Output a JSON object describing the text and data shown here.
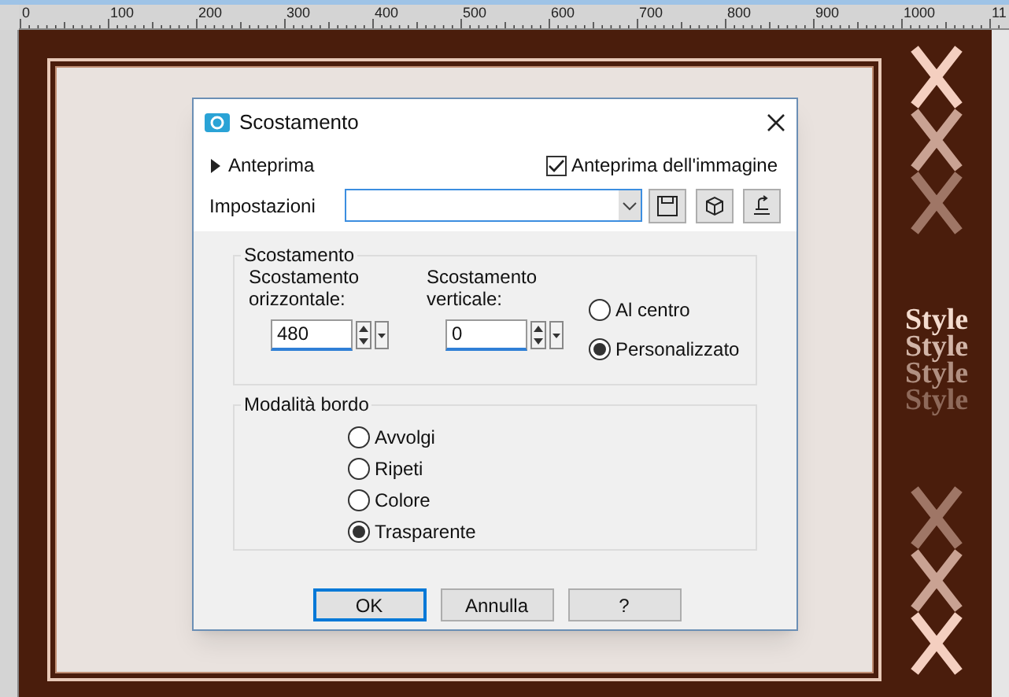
{
  "ruler": {
    "labels": [
      "0",
      "100",
      "200",
      "300",
      "400",
      "500",
      "600",
      "700",
      "800",
      "900",
      "1000",
      "11"
    ]
  },
  "artwork": {
    "style_texts": [
      "Style",
      "Style",
      "Style",
      "Style"
    ]
  },
  "dialog": {
    "title": "Scostamento",
    "preview_toggle": {
      "label": "Anteprima",
      "expanded": false
    },
    "image_preview": {
      "label": "Anteprima dell'immagine",
      "checked": true
    },
    "settings": {
      "label": "Impostazioni"
    },
    "offset_group": {
      "title": "Scostamento",
      "horizontal": {
        "label": "Scostamento orizzontale:",
        "value": "480"
      },
      "vertical": {
        "label": "Scostamento verticale:",
        "value": "0"
      },
      "options": [
        {
          "label": "Al centro",
          "selected": false
        },
        {
          "label": "Personalizzato",
          "selected": true
        }
      ]
    },
    "edge_group": {
      "title": "Modalità bordo",
      "options": [
        {
          "label": "Avvolgi",
          "selected": false
        },
        {
          "label": "Ripeti",
          "selected": false
        },
        {
          "label": "Colore",
          "selected": false
        },
        {
          "label": "Trasparente",
          "selected": true
        }
      ]
    },
    "buttons": [
      {
        "label": "OK",
        "default": true
      },
      {
        "label": "Annulla",
        "default": false
      },
      {
        "label": "?",
        "default": false
      }
    ]
  }
}
